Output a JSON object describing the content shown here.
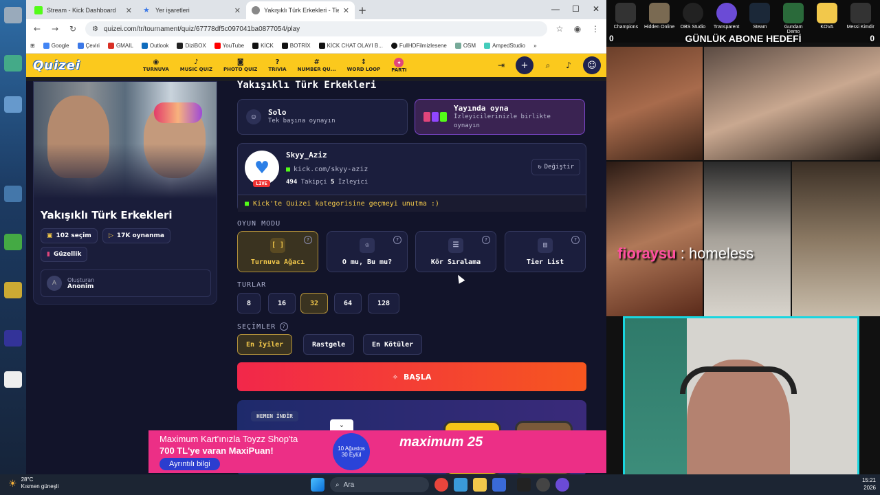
{
  "browser": {
    "tabs": [
      {
        "title": "Stream - Kick Dashboard",
        "favcolor": "#53fc18"
      },
      {
        "title": "Yer işaretleri",
        "favcolor": "#3b78e7"
      },
      {
        "title": "Yakışıklı Türk Erkekleri - Tier List",
        "favcolor": "#888888"
      }
    ],
    "url": "quizei.com/tr/tournament/quiz/67778df5c097041ba0877054/play",
    "bookmarks": [
      "Google",
      "Çeviri",
      "GMAIL",
      "Outlook",
      "DiziBOX",
      "YouTube",
      "KİCK",
      "BOTRİX",
      "KİCK CHAT OLAYI B...",
      "FullHDFilmizlesene",
      "OSM",
      "AmpedStudio"
    ],
    "bookmarks_more": "»"
  },
  "site": {
    "logo": "Quizei",
    "nav": [
      {
        "icon": "◉",
        "label": "TURNUVA"
      },
      {
        "icon": "♪",
        "label": "MUSIC QUIZ"
      },
      {
        "icon": "◙",
        "label": "PHOTO QUIZ"
      },
      {
        "icon": "?",
        "label": "TRIVIA"
      },
      {
        "icon": "#",
        "label": "NUMBER QU..."
      },
      {
        "icon": "↕",
        "label": "WORD LOOP"
      },
      {
        "icon": "✦",
        "label": "PARTI"
      }
    ]
  },
  "quiz": {
    "title": "Yakışıklı Türk Erkekleri",
    "picks": "102 seçim",
    "plays": "17K oynanma",
    "category": "Güzellik",
    "creator_label": "Oluşturan",
    "creator_name": "Anonim",
    "creator_initial": "A"
  },
  "modes": {
    "solo_title": "Solo",
    "solo_sub": "Tek başına oynayın",
    "live_title": "Yayında oyna",
    "live_sub": "İzleyicilerinizle birlikte oynayın"
  },
  "streamer": {
    "name": "Skyy_Aziz",
    "link": "kick.com/skyy-aziz",
    "followers": "494",
    "followers_label": "Takipçi",
    "viewers": "5",
    "viewers_label": "İzleyici",
    "live": "LIVE",
    "change": "Değiştir",
    "notice": "Kick'te Quizei kategorisine geçmeyi unutma :)"
  },
  "sections": {
    "game_mode": "OYUN MODU",
    "rounds": "TURLAR",
    "choices": "SEÇİMLER"
  },
  "game_modes": [
    "Turnuva Ağacı",
    "O mu, Bu mu?",
    "Kör Sıralama",
    "Tier List"
  ],
  "rounds": [
    "8",
    "16",
    "32",
    "64",
    "128"
  ],
  "choices": [
    "En İyiler",
    "Rastgele",
    "En Kötüler"
  ],
  "start_label": "BAŞLA",
  "promo_tag": "HEMEN İNDİR",
  "ad": {
    "line1": "Maximum Kart'ınızla Toyzz Shop'ta",
    "line2": "700 TL'ye varan MaxiPuan!",
    "button": "Ayrıntılı bilgi",
    "date1": "10 Ağustos",
    "date2": "30 Eylül",
    "brand": "maximum 25"
  },
  "overlay": {
    "subgoal": "GÜNLÜK ABONE HEDEFİ",
    "goal_left": "0",
    "goal_right": "0",
    "chat_user": "fioraysu",
    "chat_msg": ": homeless",
    "icons": [
      "Champions",
      "Hidden Online",
      "OBS Studio",
      "Transparent",
      "Steam",
      "Gundam Demo",
      "KOVA",
      "Messi Kimdir"
    ]
  },
  "taskbar": {
    "temp": "28°C",
    "weather": "Kısmen güneşli",
    "search": "Ara",
    "time": "15:21",
    "date": "2026"
  }
}
